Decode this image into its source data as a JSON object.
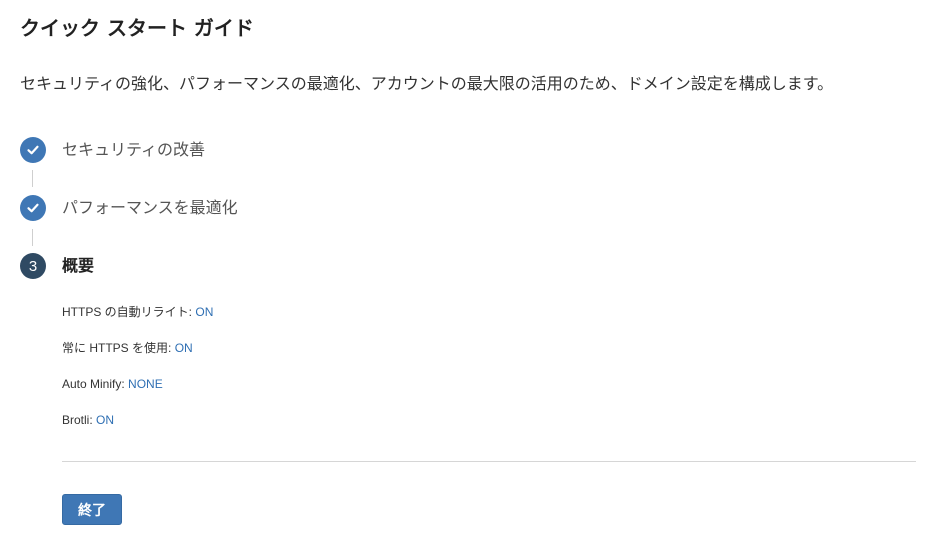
{
  "header": {
    "title": "クイック スタート ガイド",
    "description": "セキュリティの強化、パフォーマンスの最適化、アカウントの最大限の活用のため、ドメイン設定を構成します。"
  },
  "steps": [
    {
      "label": "セキュリティの改善",
      "status": "completed",
      "icon": "check-icon"
    },
    {
      "label": "パフォーマンスを最適化",
      "status": "completed",
      "icon": "check-icon"
    },
    {
      "label": "概要",
      "status": "current",
      "number": "3"
    }
  ],
  "summary": [
    {
      "label": "HTTPS の自動リライト:",
      "value": "ON"
    },
    {
      "label": "常に HTTPS を使用:",
      "value": "ON"
    },
    {
      "label": "Auto Minify:",
      "value": "NONE"
    },
    {
      "label": "Brotli:",
      "value": "ON"
    }
  ],
  "actions": {
    "finish_label": "終了"
  },
  "colors": {
    "accent": "#3f77b5",
    "current_step": "#2f4a63",
    "value_link": "#2f6fb3"
  }
}
